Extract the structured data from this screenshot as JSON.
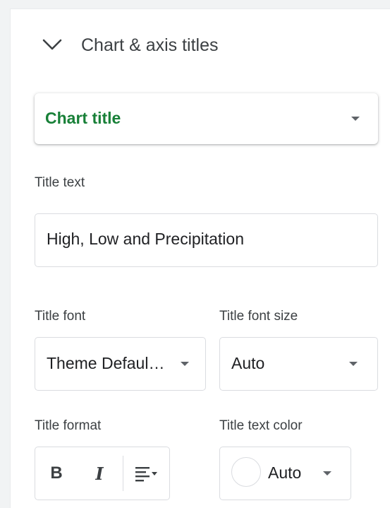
{
  "section": {
    "title": "Chart & axis titles",
    "chevron_icon": "chevron-down-icon"
  },
  "title_type_dropdown": {
    "selected": "Chart title"
  },
  "title_text": {
    "label": "Title text",
    "value": "High, Low and Precipitation"
  },
  "title_font": {
    "label": "Title font",
    "value": "Theme Defaul…"
  },
  "title_font_size": {
    "label": "Title font size",
    "value": "Auto"
  },
  "title_format": {
    "label": "Title format",
    "bold_glyph": "B",
    "italic_glyph": "I",
    "align_icon": "align-left-icon"
  },
  "title_text_color": {
    "label": "Title text color",
    "value": "Auto",
    "swatch_color": "#ffffff"
  },
  "colors": {
    "accent_green": "#188038",
    "text": "#3c4043",
    "border": "#dadce0"
  }
}
